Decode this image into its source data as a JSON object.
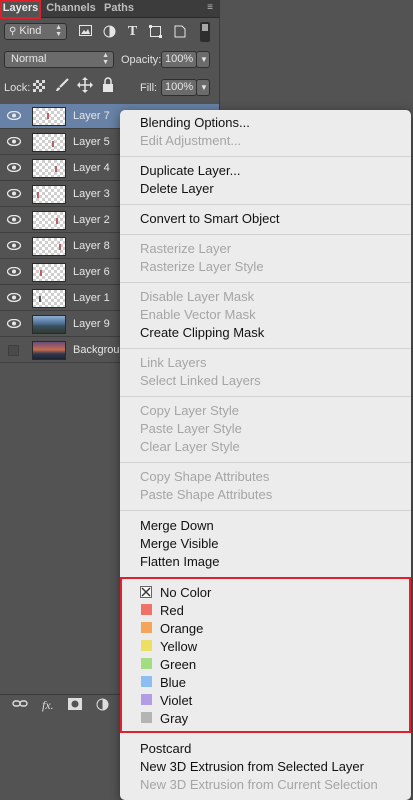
{
  "panel": {
    "tabs": [
      "Layers",
      "Channels",
      "Paths"
    ],
    "filter_kind": "Kind",
    "blend_mode": "Normal",
    "opacity_label": "Opacity:",
    "opacity_value": "100%",
    "lock_label": "Lock:",
    "fill_label": "Fill:",
    "fill_value": "100%",
    "layers": [
      {
        "name": "Layer 7",
        "selected": true
      },
      {
        "name": "Layer 5"
      },
      {
        "name": "Layer 4"
      },
      {
        "name": "Layer 3"
      },
      {
        "name": "Layer 2"
      },
      {
        "name": "Layer 8"
      },
      {
        "name": "Layer 6"
      },
      {
        "name": "Layer 1"
      },
      {
        "name": "Layer 9"
      },
      {
        "name": "Background"
      }
    ],
    "bottom_fx": "fx."
  },
  "menu": {
    "items": [
      {
        "label": "Blending Options...",
        "enabled": true
      },
      {
        "label": "Edit Adjustment...",
        "enabled": false
      },
      {
        "label": "Duplicate Layer...",
        "enabled": true
      },
      {
        "label": "Delete Layer",
        "enabled": true
      },
      {
        "label": "Convert to Smart Object",
        "enabled": true
      },
      {
        "label": "Rasterize Layer",
        "enabled": false
      },
      {
        "label": "Rasterize Layer Style",
        "enabled": false
      },
      {
        "label": "Disable Layer Mask",
        "enabled": false
      },
      {
        "label": "Enable Vector Mask",
        "enabled": false
      },
      {
        "label": "Create Clipping Mask",
        "enabled": true
      },
      {
        "label": "Link Layers",
        "enabled": false
      },
      {
        "label": "Select Linked Layers",
        "enabled": false
      },
      {
        "label": "Copy Layer Style",
        "enabled": false
      },
      {
        "label": "Paste Layer Style",
        "enabled": false
      },
      {
        "label": "Clear Layer Style",
        "enabled": false
      },
      {
        "label": "Copy Shape Attributes",
        "enabled": false
      },
      {
        "label": "Paste Shape Attributes",
        "enabled": false
      },
      {
        "label": "Merge Down",
        "enabled": true
      },
      {
        "label": "Merge Visible",
        "enabled": true
      },
      {
        "label": "Flatten Image",
        "enabled": true
      },
      {
        "label": "Postcard",
        "enabled": true
      },
      {
        "label": "New 3D Extrusion from Selected Layer",
        "enabled": true
      },
      {
        "label": "New 3D Extrusion from Current Selection",
        "enabled": false
      }
    ],
    "colors": [
      {
        "label": "No Color",
        "hex": ""
      },
      {
        "label": "Red",
        "hex": "#f0716a"
      },
      {
        "label": "Orange",
        "hex": "#f5a55a"
      },
      {
        "label": "Yellow",
        "hex": "#ecdf64"
      },
      {
        "label": "Green",
        "hex": "#a4dc84"
      },
      {
        "label": "Blue",
        "hex": "#8cbef4"
      },
      {
        "label": "Violet",
        "hex": "#b29ce6"
      },
      {
        "label": "Gray",
        "hex": "#b4b4b4"
      }
    ]
  }
}
